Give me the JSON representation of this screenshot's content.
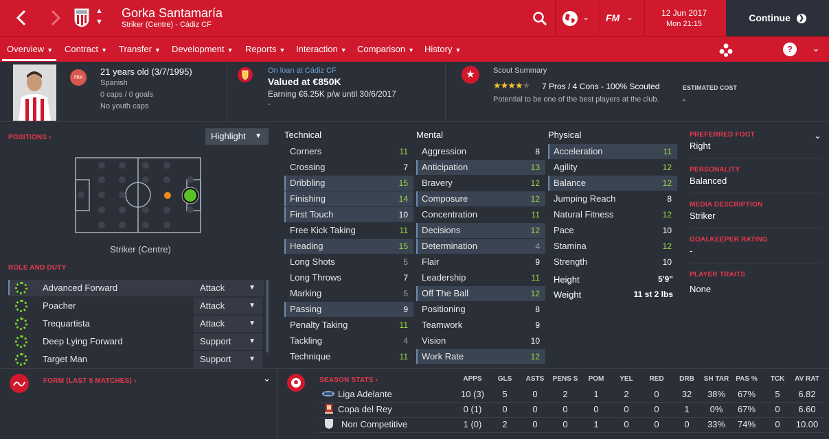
{
  "header": {
    "player_name": "Gorka Santamaría",
    "subtitle": "Striker (Centre) - Cádiz CF",
    "date": "12 Jun 2017",
    "time": "Mon 21:15",
    "continue_label": "Continue",
    "fm_label": "FM"
  },
  "nav": {
    "tabs": [
      {
        "label": "Overview"
      },
      {
        "label": "Contract"
      },
      {
        "label": "Transfer"
      },
      {
        "label": "Development"
      },
      {
        "label": "Reports"
      },
      {
        "label": "Interaction"
      },
      {
        "label": "Comparison"
      },
      {
        "label": "History"
      }
    ]
  },
  "info": {
    "badge_label": "Hol",
    "age": "21 years old (3/7/1995)",
    "nationality": "Spanish",
    "caps": "0 caps / 0 goals",
    "youth_caps": "No youth caps",
    "loan_text": "On loan at Cádiz CF",
    "value": "Valued at €850K",
    "earning": "Earning €6.25K p/w until 30/6/2017",
    "earning_sub": "-",
    "scout_title": "Scout Summary",
    "scout_rating_stars": 4,
    "scout_line": "7 Pros / 4 Cons - 100% Scouted",
    "scout_potential": "Potential to be one of the best players at the club.",
    "estimated_cost_label": "ESTIMATED COST",
    "estimated_cost_value": "-"
  },
  "positions": {
    "title": "POSITIONS",
    "highlight_label": "Highlight",
    "position_caption": "Striker (Centre)"
  },
  "role_duty": {
    "title": "ROLE AND DUTY",
    "roles": [
      {
        "name": "Advanced Forward",
        "duty": "Attack"
      },
      {
        "name": "Poacher",
        "duty": "Attack"
      },
      {
        "name": "Trequartista",
        "duty": "Attack"
      },
      {
        "name": "Deep Lying Forward",
        "duty": "Support"
      },
      {
        "name": "Target Man",
        "duty": "Support"
      }
    ]
  },
  "attributes": {
    "technical_title": "Technical",
    "mental_title": "Mental",
    "physical_title": "Physical",
    "technical": [
      {
        "name": "Corners",
        "value": "11"
      },
      {
        "name": "Crossing",
        "value": "7"
      },
      {
        "name": "Dribbling",
        "value": "15"
      },
      {
        "name": "Finishing",
        "value": "14"
      },
      {
        "name": "First Touch",
        "value": "10"
      },
      {
        "name": "Free Kick Taking",
        "value": "11"
      },
      {
        "name": "Heading",
        "value": "15"
      },
      {
        "name": "Long Shots",
        "value": "5"
      },
      {
        "name": "Long Throws",
        "value": "7"
      },
      {
        "name": "Marking",
        "value": "5"
      },
      {
        "name": "Passing",
        "value": "9"
      },
      {
        "name": "Penalty Taking",
        "value": "11"
      },
      {
        "name": "Tackling",
        "value": "4"
      },
      {
        "name": "Technique",
        "value": "11"
      }
    ],
    "mental": [
      {
        "name": "Aggression",
        "value": "8"
      },
      {
        "name": "Anticipation",
        "value": "13"
      },
      {
        "name": "Bravery",
        "value": "12"
      },
      {
        "name": "Composure",
        "value": "12"
      },
      {
        "name": "Concentration",
        "value": "11"
      },
      {
        "name": "Decisions",
        "value": "12"
      },
      {
        "name": "Determination",
        "value": "4"
      },
      {
        "name": "Flair",
        "value": "9"
      },
      {
        "name": "Leadership",
        "value": "11"
      },
      {
        "name": "Off The Ball",
        "value": "12"
      },
      {
        "name": "Positioning",
        "value": "8"
      },
      {
        "name": "Teamwork",
        "value": "9"
      },
      {
        "name": "Vision",
        "value": "10"
      },
      {
        "name": "Work Rate",
        "value": "12"
      }
    ],
    "physical": [
      {
        "name": "Acceleration",
        "value": "11"
      },
      {
        "name": "Agility",
        "value": "12"
      },
      {
        "name": "Balance",
        "value": "12"
      },
      {
        "name": "Jumping Reach",
        "value": "8"
      },
      {
        "name": "Natural Fitness",
        "value": "12"
      },
      {
        "name": "Pace",
        "value": "10"
      },
      {
        "name": "Stamina",
        "value": "12"
      },
      {
        "name": "Strength",
        "value": "10"
      }
    ],
    "height_label": "Height",
    "height_value": "5'9\"",
    "weight_label": "Weight",
    "weight_value": "11 st 2 lbs"
  },
  "side": {
    "preferred_foot_label": "PREFERRED FOOT",
    "preferred_foot": "Right",
    "personality_label": "PERSONALITY",
    "personality": "Balanced",
    "media_label": "MEDIA DESCRIPTION",
    "media": "Striker",
    "gk_label": "GOALKEEPER RATING",
    "gk": "-",
    "traits_label": "PLAYER TRAITS",
    "traits": "None"
  },
  "form": {
    "title": "FORM (LAST 5 MATCHES)"
  },
  "season_stats": {
    "title": "SEASON STATS",
    "headers": [
      "APPS",
      "GLS",
      "ASTS",
      "PENS S",
      "POM",
      "YEL",
      "RED",
      "DRB",
      "SH TAR",
      "PAS %",
      "TCK",
      "AV RAT"
    ],
    "rows": [
      {
        "competition": "Liga Adelante",
        "values": [
          "10 (3)",
          "5",
          "0",
          "2",
          "1",
          "2",
          "0",
          "32",
          "38%",
          "67%",
          "5",
          "6.82"
        ]
      },
      {
        "competition": "Copa del Rey",
        "values": [
          "0 (1)",
          "0",
          "0",
          "0",
          "0",
          "0",
          "0",
          "1",
          "0%",
          "67%",
          "0",
          "6.60"
        ]
      },
      {
        "competition": "Non Competitive",
        "values": [
          "1 (0)",
          "2",
          "0",
          "0",
          "1",
          "0",
          "0",
          "0",
          "33%",
          "74%",
          "0",
          "10.00"
        ]
      }
    ]
  },
  "colors": {
    "brand_red": "#d0192c",
    "panel_bg": "#2a2f38",
    "high_value_green": "#9bdc42",
    "highlight_row": "#3a4452"
  }
}
